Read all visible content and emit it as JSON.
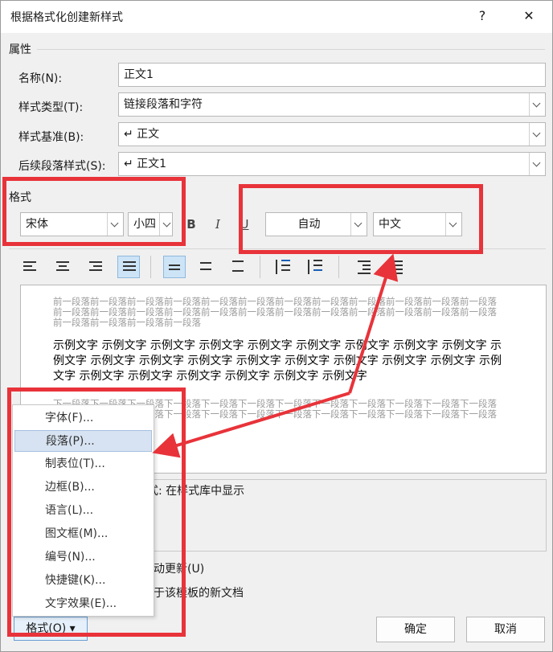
{
  "title": "根据格式化创建新样式",
  "title_buttons": {
    "help": "?",
    "close": "✕"
  },
  "properties": {
    "group_label": "属性",
    "name_label": "名称(N):",
    "name_value": "正文1",
    "type_label": "样式类型(T):",
    "type_value": "链接段落和字符",
    "base_label": "样式基准(B):",
    "base_value": "↵ 正文",
    "next_label": "后续段落样式(S):",
    "next_value": "↵ 正文1"
  },
  "format": {
    "group_label": "格式",
    "font": "宋体",
    "size": "小四",
    "bold": "B",
    "italic": "I",
    "underline": "U",
    "color": "自动",
    "language": "中文"
  },
  "preview": {
    "prev_paragraph": "前一段落前一段落前一段落前一段落前一段落前一段落前一段落前一段落前一段落前一段落前一段落前一段落前一段落前一段落前一段落前一段落前一段落前一段落前一段落前一段落前一段落前一段落前一段落前一段落前一段落前一段落前一段落前一段落",
    "sample_text": "示例文字 示例文字 示例文字 示例文字 示例文字 示例文字 示例文字 示例文字 示例文字 示例文字 示例文字 示例文字 示例文字 示例文字 示例文字 示例文字 示例文字 示例文字 示例文字 示例文字 示例文字 示例文字 示例文字 示例文字 示例文字",
    "next_paragraph": "下一段落下一段落下一段落下一段落下一段落下一段落下一段落下一段落下一段落下一段落下一段落下一段落下一段落下一段落下一段落下一段落下一段落下一段落下一段落下一段落下一段落下一段落下一段落下一段落"
  },
  "description": {
    "text": "样式: 在样式库中显示"
  },
  "options": {
    "auto_update": "动更新(U)",
    "template": "于该模板的新文档"
  },
  "menu": {
    "items": [
      {
        "label": "字体(F)..."
      },
      {
        "label": "段落(P)..."
      },
      {
        "label": "制表位(T)..."
      },
      {
        "label": "边框(B)..."
      },
      {
        "label": "语言(L)..."
      },
      {
        "label": "图文框(M)..."
      },
      {
        "label": "编号(N)..."
      },
      {
        "label": "快捷键(K)..."
      },
      {
        "label": "文字效果(E)..."
      }
    ],
    "highlighted_index": 1
  },
  "buttons": {
    "format": "格式(O) ▾",
    "ok": "确定",
    "cancel": "取消"
  },
  "colors": {
    "annotation": "#e8333a",
    "highlight": "#d7e3f2"
  }
}
